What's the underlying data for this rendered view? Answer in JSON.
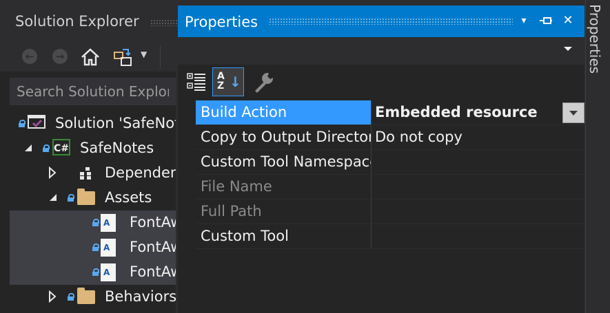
{
  "solution_explorer": {
    "title": "Solution Explorer",
    "toolbar": {
      "back_icon": "back-arrow-icon",
      "forward_icon": "forward-arrow-icon",
      "home_icon": "home-icon",
      "sync_icon": "sync-view-icon"
    },
    "search": {
      "placeholder": "Search Solution Explorer"
    },
    "tree": [
      {
        "label": "Solution 'SafeNotes'",
        "icon": "solution-icon"
      },
      {
        "label": "SafeNotes",
        "icon": "csharp-project-icon"
      },
      {
        "label": "Dependencies",
        "icon": "dependencies-icon"
      },
      {
        "label": "Assets",
        "icon": "folder-icon"
      },
      {
        "label": "FontAwesome",
        "icon": "font-file-icon"
      },
      {
        "label": "FontAwesome",
        "icon": "font-file-icon"
      },
      {
        "label": "FontAwesome",
        "icon": "font-file-icon"
      },
      {
        "label": "Behaviors",
        "icon": "folder-icon"
      }
    ]
  },
  "properties": {
    "title": "Properties",
    "title_buttons": {
      "dropdown": "▾",
      "pin": "pin-icon",
      "close": "✕"
    },
    "toolbar": {
      "categorized_icon": "categorized-icon",
      "alphabetical_label": "AZ",
      "property_pages_icon": "wrench-icon"
    },
    "rows": [
      {
        "name": "Build Action",
        "value": "Embedded resource"
      },
      {
        "name": "Copy to Output Directory",
        "value": "Do not copy"
      },
      {
        "name": "Custom Tool Namespace",
        "value": ""
      },
      {
        "name": "File Name",
        "value": ""
      },
      {
        "name": "Full Path",
        "value": ""
      },
      {
        "name": "Custom Tool",
        "value": ""
      }
    ]
  },
  "side_tab": {
    "label": "Properties"
  },
  "colors": {
    "accent": "#007acc",
    "selection": "#3399ff",
    "background": "#252526",
    "chrome": "#2d2d30"
  }
}
